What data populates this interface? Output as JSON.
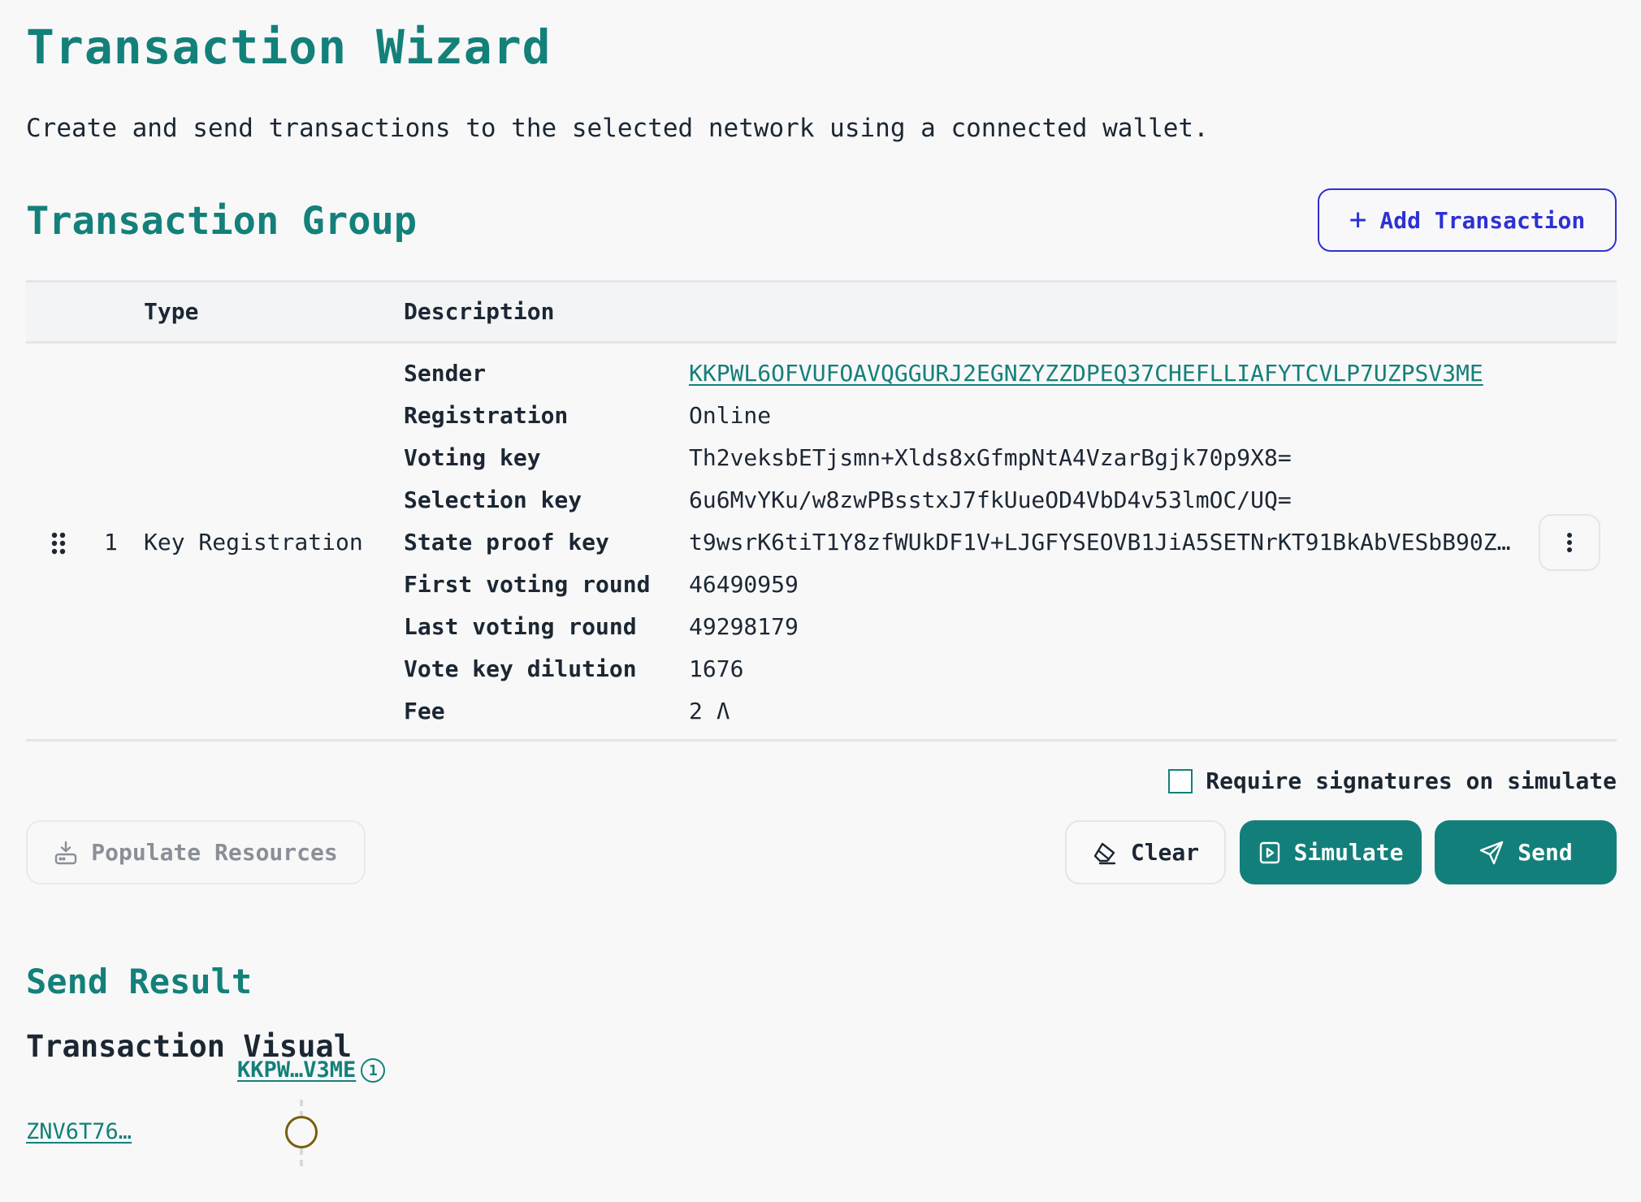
{
  "page": {
    "title": "Transaction Wizard",
    "subtitle": "Create and send transactions to the selected network using a connected wallet."
  },
  "group": {
    "heading": "Transaction Group",
    "add_button_icon": "plus-icon",
    "add_button_label": "Add Transaction",
    "columns": [
      "Type",
      "Description"
    ],
    "rows": [
      {
        "index": "1",
        "type": "Key Registration",
        "fields": [
          {
            "label": "Sender",
            "value": "KKPWL6OFVUFOAVQGGURJ2EGNZYZZDPEQ37CHEFLLIAFYTCVLP7UZPSV3ME"
          },
          {
            "label": "Registration",
            "value": "Online"
          },
          {
            "label": "Voting key",
            "value": "Th2veksbETjsmn+Xlds8xGfmpNtA4VzarBgjk70p9X8="
          },
          {
            "label": "Selection key",
            "value": "6u6MvYKu/w8zwPBsstxJ7fkUueOD4VbD4v53lmOC/UQ="
          },
          {
            "label": "State proof key",
            "value": "t9wsrK6tiT1Y8zfWUkDF1V+LJGFYSEOVB1JiA5SETNrKT91BkAbVESbB90Z…"
          },
          {
            "label": "First voting round",
            "value": "46490959"
          },
          {
            "label": "Last voting round",
            "value": "49298179"
          },
          {
            "label": "Vote key dilution",
            "value": "1676"
          },
          {
            "label": "Fee",
            "value": "2 Ʌ"
          }
        ]
      }
    ]
  },
  "options": {
    "require_signatures_label": "Require signatures on simulate",
    "require_signatures_checked": false
  },
  "actions": {
    "populate": "Populate Resources",
    "clear": "Clear",
    "simulate": "Simulate",
    "send": "Send"
  },
  "result": {
    "heading": "Send Result",
    "visual_heading": "Transaction Visual",
    "account_top": "KKPW…V3ME",
    "account_top_badge": "1",
    "account_left": "ZNV6T76…"
  },
  "colors": {
    "accent": "#14807a",
    "add_button": "#2e31d1",
    "node_stroke": "#7a5f0a"
  }
}
